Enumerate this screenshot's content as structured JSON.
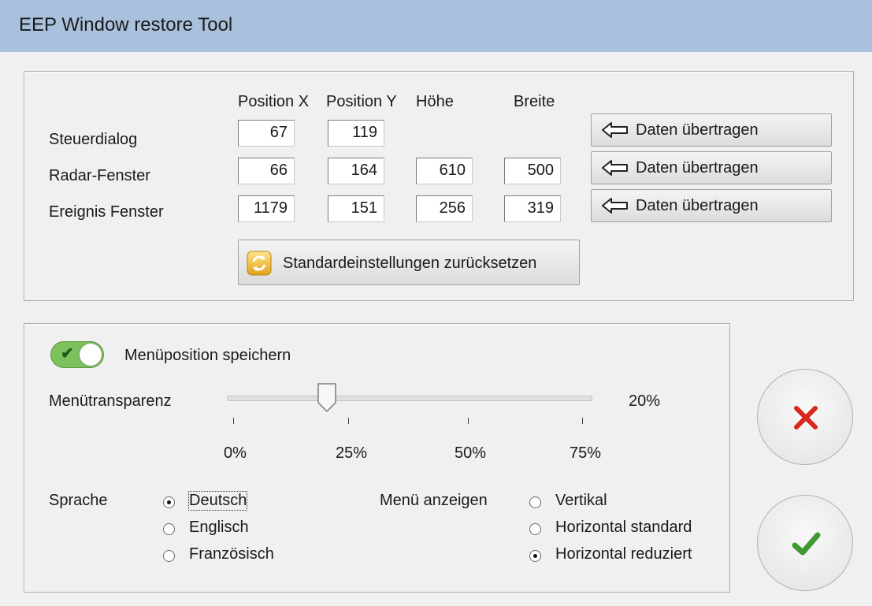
{
  "window": {
    "title": "EEP Window restore Tool"
  },
  "positions": {
    "headers": {
      "x": "Position X",
      "y": "Position Y",
      "height": "Höhe",
      "width": "Breite"
    },
    "rows": [
      {
        "label": "Steuerdialog",
        "x": "67",
        "y": "119",
        "height": null,
        "width": null,
        "button": "Daten übertragen"
      },
      {
        "label": "Radar-Fenster",
        "x": "66",
        "y": "164",
        "height": "610",
        "width": "500",
        "button": "Daten übertragen"
      },
      {
        "label": "Ereignis Fenster",
        "x": "1179",
        "y": "151",
        "height": "256",
        "width": "319",
        "button": "Daten übertragen"
      }
    ],
    "reset_button": "Standardeinstellungen zurücksetzen"
  },
  "settings": {
    "save_menu_position": {
      "label": "Menüposition speichern",
      "on": true
    },
    "transparency": {
      "label": "Menütransparenz",
      "value": 20,
      "value_text": "20%",
      "ticks": [
        "0%",
        "25%",
        "50%",
        "75%"
      ]
    },
    "language": {
      "label": "Sprache",
      "options": [
        "Deutsch",
        "Englisch",
        "Französisch"
      ],
      "selected": "Deutsch"
    },
    "menu_display": {
      "label": "Menü anzeigen",
      "options": [
        "Vertikal",
        "Horizontal standard",
        "Horizontal reduziert"
      ],
      "selected": "Horizontal reduziert"
    }
  },
  "actions": {
    "cancel_icon": "red-x-icon",
    "ok_icon": "green-check-icon"
  },
  "colors": {
    "titlebar": "#a9c1dc",
    "toggle_on": "#7dc05e",
    "cancel": "#d9281e",
    "ok": "#3c9a2f"
  }
}
